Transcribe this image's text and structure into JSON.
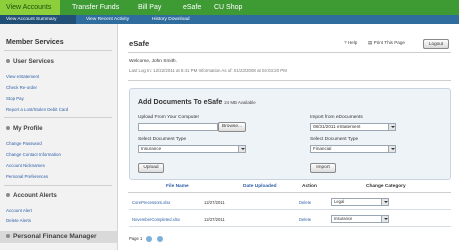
{
  "top_nav": {
    "tabs": [
      {
        "label": "View Accounts",
        "active": true
      },
      {
        "label": "Transfer Funds",
        "active": false
      },
      {
        "label": "Bill Pay",
        "active": false
      },
      {
        "label": "eSafe",
        "active": false
      },
      {
        "label": "CU Shop",
        "active": false
      }
    ]
  },
  "sub_nav": {
    "items": [
      {
        "label": "View Account Summary",
        "active": true
      },
      {
        "label": "View Recent Activity",
        "active": false
      },
      {
        "label": "History Download",
        "active": false
      }
    ]
  },
  "sidebar": {
    "title": "Member Services",
    "sections": [
      {
        "heading": "User Services",
        "links": [
          "View eStatement",
          "Check Re-order",
          "Stop Pay",
          "Report a Lost/Stolen Debit Card"
        ]
      },
      {
        "heading": "My Profile",
        "links": [
          "Change Password",
          "Change Contact Information",
          "Account Nicknames",
          "Personal Preferences"
        ]
      },
      {
        "heading": "Account Alerts",
        "links": [
          "Account Alert",
          "Delete Alerts"
        ]
      },
      {
        "heading": "Personal Finance Manager",
        "links": []
      }
    ]
  },
  "main": {
    "title": "eSafe",
    "help_label": "Help",
    "print_label": "Print This Page",
    "logout_label": "Logout",
    "welcome": "Welcome, John Smith.",
    "last_login": "Last Log In: 12/22/2011 at 5:41 PM  Information As of: 01/23/2008 at 04:03:20 PM"
  },
  "add_docs": {
    "title": "Add Documents To eSafe",
    "available": "24 MB Available",
    "upload_label": "Upload From Your Computer",
    "browse_label": "Browse...",
    "doc_type_label_left": "Select Document Type",
    "doc_type_value_left": "Insurance",
    "upload_button": "Upload",
    "import_label": "Import from eDocuments",
    "import_value": "08/31/2011 eStatement",
    "doc_type_label_right": "Select Document Type",
    "doc_type_value_right": "Financial",
    "import_button": "Import"
  },
  "table": {
    "headers": [
      "File Name",
      "Date Uploaded",
      "Action",
      "Change Category"
    ],
    "rows": [
      {
        "file": "CorePrecessors.xlsx",
        "date": "12/27/2011",
        "action": "Delete",
        "category": "Legal"
      },
      {
        "file": "NovemberCompleted.xlsx",
        "date": "12/27/2011",
        "action": "Delete",
        "category": "Insurance"
      }
    ],
    "page_label": "Page",
    "page_number": "1"
  },
  "colors": {
    "top_nav_green": "#3e9b34",
    "active_tab_green": "#8ccf3a",
    "sub_nav_blue": "#2f6d9e",
    "link_blue": "#2d5fa6"
  }
}
